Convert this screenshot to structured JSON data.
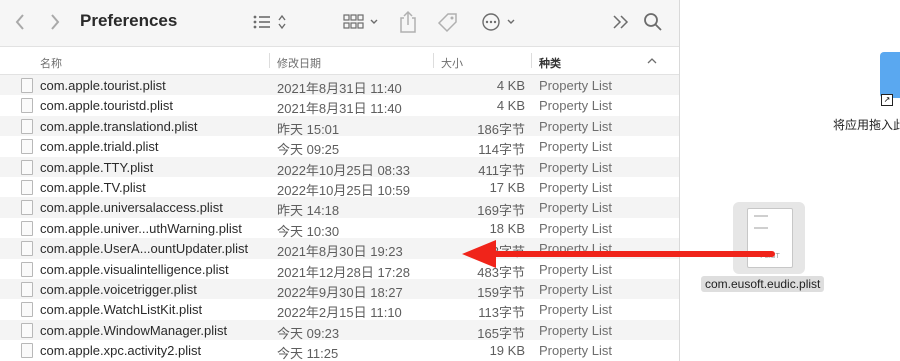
{
  "window": {
    "title": "Preferences"
  },
  "columns": {
    "name": "名称",
    "date": "修改日期",
    "size": "大小",
    "kind": "种类"
  },
  "files": [
    {
      "name": "com.apple.tourist.plist",
      "date": "2021年8月31日 11:40",
      "size": "4 KB",
      "kind": "Property List"
    },
    {
      "name": "com.apple.touristd.plist",
      "date": "2021年8月31日 11:40",
      "size": "4 KB",
      "kind": "Property List"
    },
    {
      "name": "com.apple.translationd.plist",
      "date": "昨天 15:01",
      "size": "186字节",
      "kind": "Property List"
    },
    {
      "name": "com.apple.triald.plist",
      "date": "今天 09:25",
      "size": "114字节",
      "kind": "Property List"
    },
    {
      "name": "com.apple.TTY.plist",
      "date": "2022年10月25日 08:33",
      "size": "411字节",
      "kind": "Property List"
    },
    {
      "name": "com.apple.TV.plist",
      "date": "2022年10月25日 10:59",
      "size": "17 KB",
      "kind": "Property List"
    },
    {
      "name": "com.apple.universalaccess.plist",
      "date": "昨天 14:18",
      "size": "169字节",
      "kind": "Property List"
    },
    {
      "name": "com.apple.univer...uthWarning.plist",
      "date": "今天 10:30",
      "size": "18 KB",
      "kind": "Property List"
    },
    {
      "name": "com.apple.UserA...ountUpdater.plist",
      "date": "2021年8月30日 19:23",
      "size": "93字节",
      "kind": "Property List"
    },
    {
      "name": "com.apple.visualintelligence.plist",
      "date": "2021年12月28日 17:28",
      "size": "483字节",
      "kind": "Property List"
    },
    {
      "name": "com.apple.voicetrigger.plist",
      "date": "2022年9月30日 18:27",
      "size": "159字节",
      "kind": "Property List"
    },
    {
      "name": "com.apple.WatchListKit.plist",
      "date": "2022年2月15日 11:10",
      "size": "113字节",
      "kind": "Property List"
    },
    {
      "name": "com.apple.WindowManager.plist",
      "date": "今天 09:23",
      "size": "165字节",
      "kind": "Property List"
    },
    {
      "name": "com.apple.xpc.activity2.plist",
      "date": "今天 11:25",
      "size": "19 KB",
      "kind": "Property List"
    }
  ],
  "desktop": {
    "applications_alias_label": "将应用拖入此",
    "dragged_file_label": "com.eusoft.eudic.plist",
    "dragged_file_ext": "PLIST"
  },
  "annotation": {
    "arrow_color": "#f0241a"
  },
  "icons": [
    "back-icon",
    "forward-icon",
    "list-view-icon",
    "group-icon",
    "share-icon",
    "tag-icon",
    "action-icon",
    "more-icon",
    "search-icon",
    "sort-chevron-icon"
  ]
}
